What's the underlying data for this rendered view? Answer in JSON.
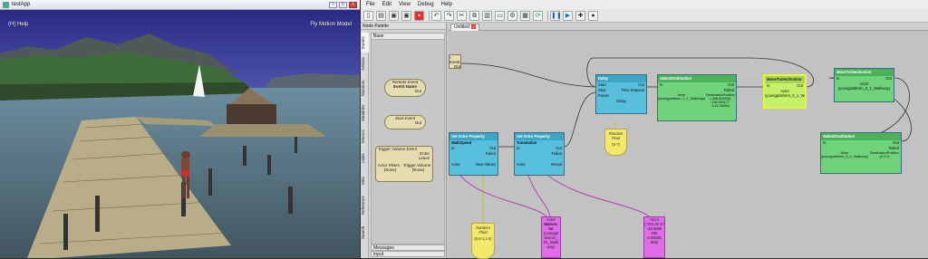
{
  "left_window": {
    "title": "testApp",
    "overlay_left": "(H) Help",
    "overlay_right": "Fly Motion Model"
  },
  "menu": [
    "File",
    "Edit",
    "View",
    "Debug",
    "Help"
  ],
  "palette": {
    "header": "Node Palette",
    "section": "Base",
    "vertical_tabs": [
      "Events",
      "Actions",
      "Mutators",
      "Variables",
      "Macros",
      "Links",
      "Misc",
      "Reference",
      "Search"
    ],
    "nodes": {
      "remote_event": [
        "Remote Event",
        "Event Name",
        "Out"
      ],
      "start_event": [
        "Start Event",
        "Out"
      ],
      "trigger_volume": [
        "Trigger Volume Event",
        "Enter",
        "Leave",
        "Actor Filters",
        "(None)",
        "Trigger Volume",
        "(None)"
      ]
    },
    "footer": [
      "Messages",
      "Input"
    ]
  },
  "tab": {
    "label": "Untitled"
  },
  "graph": {
    "event_stub": {
      "label": "t Event",
      "out": "Out"
    },
    "delay": {
      "title": "Delay",
      "in": [
        "Start",
        "Stop",
        "Pause"
      ],
      "out": [
        "Out",
        "Time Elapsed"
      ],
      "foot": "Delay"
    },
    "select1": {
      "title": "SelectDestination",
      "in": "In",
      "out": [
        "Out",
        "Failed"
      ],
      "props": [
        "Actor",
        "(youngplatform_0_1_Walkway)",
        "DestinationPosition",
        "(-468.804838, -118.969177, 4.4178658)"
      ]
    },
    "move1": {
      "title": "MoveToDestination",
      "in": "In",
      "out": "Out",
      "props": [
        "Actor",
        "(youngplatform_0_1_Walkway)"
      ]
    },
    "move2": {
      "title": "MoveToDestination",
      "in": "In",
      "out": "Out",
      "props": [
        "Actor",
        "(youngplatform_0_1_Walkway)"
      ]
    },
    "select2": {
      "title": "SelectDestination",
      "in": "In",
      "out": [
        "Out",
        "Failed"
      ],
      "props": [
        "Actor",
        "(youngplatform_0_1_Walkway)",
        "DestinationPosition",
        "(0 0 0)"
      ]
    },
    "set1": {
      "title": "Set Actor Property",
      "sub": "WalkSpeed",
      "in": "In",
      "out": [
        "Out",
        "Failed"
      ],
      "foot": [
        "Actor",
        "New Values"
      ]
    },
    "set2": {
      "title": "Set Actor Property",
      "sub": "Translation",
      "in": "In",
      "out": [
        "Out",
        "Failed"
      ],
      "foot": [
        "Actor",
        "Result"
      ]
    },
    "rand1": {
      "title": "Random Float",
      "value": "(5-7)"
    },
    "rand2": {
      "title": "Random Float",
      "value": "(8.5-1.2 5)"
    },
    "actor_var": {
      "title": "Actor",
      "value": "MainAc tor",
      "detail": "(youngpl ammer_ 01_Walk way)"
    },
    "vec_var": {
      "title": "Vec3",
      "value": "(-763.29 47 -46.5598 205 6.99035 896)"
    }
  },
  "colors": {
    "accent": "#58c0dc",
    "green": "#6ed37b",
    "event": "#e7dcb0",
    "var": "#e06ce8",
    "float": "#f2e96a"
  }
}
